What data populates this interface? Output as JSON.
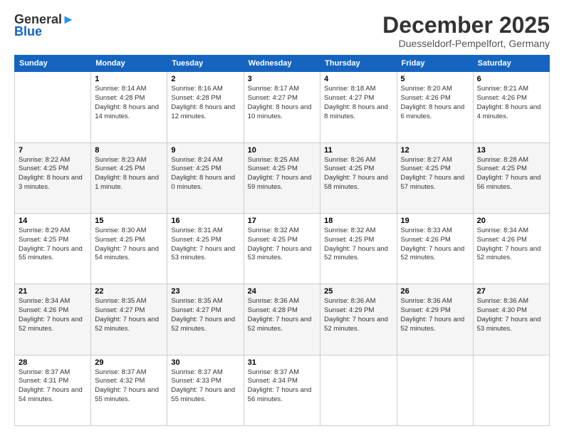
{
  "header": {
    "logo_general": "General",
    "logo_blue": "Blue",
    "month_title": "December 2025",
    "location": "Duesseldorf-Pempelfort, Germany"
  },
  "days_of_week": [
    "Sunday",
    "Monday",
    "Tuesday",
    "Wednesday",
    "Thursday",
    "Friday",
    "Saturday"
  ],
  "weeks": [
    [
      {
        "num": "",
        "sunrise": "",
        "sunset": "",
        "daylight": ""
      },
      {
        "num": "1",
        "sunrise": "Sunrise: 8:14 AM",
        "sunset": "Sunset: 4:28 PM",
        "daylight": "Daylight: 8 hours and 14 minutes."
      },
      {
        "num": "2",
        "sunrise": "Sunrise: 8:16 AM",
        "sunset": "Sunset: 4:28 PM",
        "daylight": "Daylight: 8 hours and 12 minutes."
      },
      {
        "num": "3",
        "sunrise": "Sunrise: 8:17 AM",
        "sunset": "Sunset: 4:27 PM",
        "daylight": "Daylight: 8 hours and 10 minutes."
      },
      {
        "num": "4",
        "sunrise": "Sunrise: 8:18 AM",
        "sunset": "Sunset: 4:27 PM",
        "daylight": "Daylight: 8 hours and 8 minutes."
      },
      {
        "num": "5",
        "sunrise": "Sunrise: 8:20 AM",
        "sunset": "Sunset: 4:26 PM",
        "daylight": "Daylight: 8 hours and 6 minutes."
      },
      {
        "num": "6",
        "sunrise": "Sunrise: 8:21 AM",
        "sunset": "Sunset: 4:26 PM",
        "daylight": "Daylight: 8 hours and 4 minutes."
      }
    ],
    [
      {
        "num": "7",
        "sunrise": "Sunrise: 8:22 AM",
        "sunset": "Sunset: 4:25 PM",
        "daylight": "Daylight: 8 hours and 3 minutes."
      },
      {
        "num": "8",
        "sunrise": "Sunrise: 8:23 AM",
        "sunset": "Sunset: 4:25 PM",
        "daylight": "Daylight: 8 hours and 1 minute."
      },
      {
        "num": "9",
        "sunrise": "Sunrise: 8:24 AM",
        "sunset": "Sunset: 4:25 PM",
        "daylight": "Daylight: 8 hours and 0 minutes."
      },
      {
        "num": "10",
        "sunrise": "Sunrise: 8:25 AM",
        "sunset": "Sunset: 4:25 PM",
        "daylight": "Daylight: 7 hours and 59 minutes."
      },
      {
        "num": "11",
        "sunrise": "Sunrise: 8:26 AM",
        "sunset": "Sunset: 4:25 PM",
        "daylight": "Daylight: 7 hours and 58 minutes."
      },
      {
        "num": "12",
        "sunrise": "Sunrise: 8:27 AM",
        "sunset": "Sunset: 4:25 PM",
        "daylight": "Daylight: 7 hours and 57 minutes."
      },
      {
        "num": "13",
        "sunrise": "Sunrise: 8:28 AM",
        "sunset": "Sunset: 4:25 PM",
        "daylight": "Daylight: 7 hours and 56 minutes."
      }
    ],
    [
      {
        "num": "14",
        "sunrise": "Sunrise: 8:29 AM",
        "sunset": "Sunset: 4:25 PM",
        "daylight": "Daylight: 7 hours and 55 minutes."
      },
      {
        "num": "15",
        "sunrise": "Sunrise: 8:30 AM",
        "sunset": "Sunset: 4:25 PM",
        "daylight": "Daylight: 7 hours and 54 minutes."
      },
      {
        "num": "16",
        "sunrise": "Sunrise: 8:31 AM",
        "sunset": "Sunset: 4:25 PM",
        "daylight": "Daylight: 7 hours and 53 minutes."
      },
      {
        "num": "17",
        "sunrise": "Sunrise: 8:32 AM",
        "sunset": "Sunset: 4:25 PM",
        "daylight": "Daylight: 7 hours and 53 minutes."
      },
      {
        "num": "18",
        "sunrise": "Sunrise: 8:32 AM",
        "sunset": "Sunset: 4:25 PM",
        "daylight": "Daylight: 7 hours and 52 minutes."
      },
      {
        "num": "19",
        "sunrise": "Sunrise: 8:33 AM",
        "sunset": "Sunset: 4:26 PM",
        "daylight": "Daylight: 7 hours and 52 minutes."
      },
      {
        "num": "20",
        "sunrise": "Sunrise: 8:34 AM",
        "sunset": "Sunset: 4:26 PM",
        "daylight": "Daylight: 7 hours and 52 minutes."
      }
    ],
    [
      {
        "num": "21",
        "sunrise": "Sunrise: 8:34 AM",
        "sunset": "Sunset: 4:26 PM",
        "daylight": "Daylight: 7 hours and 52 minutes."
      },
      {
        "num": "22",
        "sunrise": "Sunrise: 8:35 AM",
        "sunset": "Sunset: 4:27 PM",
        "daylight": "Daylight: 7 hours and 52 minutes."
      },
      {
        "num": "23",
        "sunrise": "Sunrise: 8:35 AM",
        "sunset": "Sunset: 4:27 PM",
        "daylight": "Daylight: 7 hours and 52 minutes."
      },
      {
        "num": "24",
        "sunrise": "Sunrise: 8:36 AM",
        "sunset": "Sunset: 4:28 PM",
        "daylight": "Daylight: 7 hours and 52 minutes."
      },
      {
        "num": "25",
        "sunrise": "Sunrise: 8:36 AM",
        "sunset": "Sunset: 4:29 PM",
        "daylight": "Daylight: 7 hours and 52 minutes."
      },
      {
        "num": "26",
        "sunrise": "Sunrise: 8:36 AM",
        "sunset": "Sunset: 4:29 PM",
        "daylight": "Daylight: 7 hours and 52 minutes."
      },
      {
        "num": "27",
        "sunrise": "Sunrise: 8:36 AM",
        "sunset": "Sunset: 4:30 PM",
        "daylight": "Daylight: 7 hours and 53 minutes."
      }
    ],
    [
      {
        "num": "28",
        "sunrise": "Sunrise: 8:37 AM",
        "sunset": "Sunset: 4:31 PM",
        "daylight": "Daylight: 7 hours and 54 minutes."
      },
      {
        "num": "29",
        "sunrise": "Sunrise: 8:37 AM",
        "sunset": "Sunset: 4:32 PM",
        "daylight": "Daylight: 7 hours and 55 minutes."
      },
      {
        "num": "30",
        "sunrise": "Sunrise: 8:37 AM",
        "sunset": "Sunset: 4:33 PM",
        "daylight": "Daylight: 7 hours and 55 minutes."
      },
      {
        "num": "31",
        "sunrise": "Sunrise: 8:37 AM",
        "sunset": "Sunset: 4:34 PM",
        "daylight": "Daylight: 7 hours and 56 minutes."
      },
      {
        "num": "",
        "sunrise": "",
        "sunset": "",
        "daylight": ""
      },
      {
        "num": "",
        "sunrise": "",
        "sunset": "",
        "daylight": ""
      },
      {
        "num": "",
        "sunrise": "",
        "sunset": "",
        "daylight": ""
      }
    ]
  ]
}
